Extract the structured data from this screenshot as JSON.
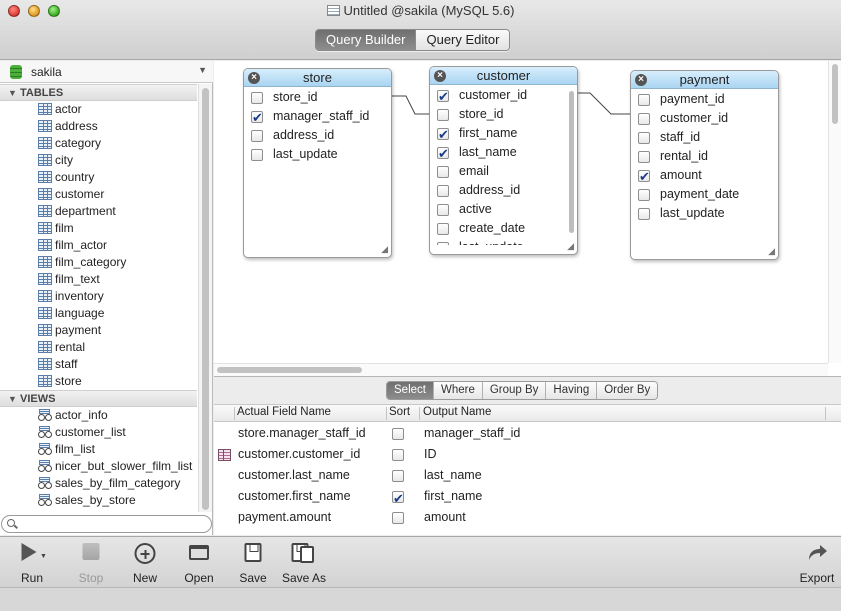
{
  "window": {
    "title": "Untitled @sakila (MySQL 5.6)"
  },
  "mode_tabs": [
    {
      "label": "Query Builder",
      "active": true
    },
    {
      "label": "Query Editor",
      "active": false
    }
  ],
  "sidebar": {
    "database": "sakila",
    "tables_header": "TABLES",
    "tables": [
      "actor",
      "address",
      "category",
      "city",
      "country",
      "customer",
      "department",
      "film",
      "film_actor",
      "film_category",
      "film_text",
      "inventory",
      "language",
      "payment",
      "rental",
      "staff",
      "store"
    ],
    "views_header": "VIEWS",
    "views": [
      "actor_info",
      "customer_list",
      "film_list",
      "nicer_but_slower_film_list",
      "sales_by_film_category",
      "sales_by_store"
    ],
    "search_placeholder": ""
  },
  "canvas": {
    "tables": [
      {
        "name": "store",
        "fields": [
          {
            "name": "store_id",
            "checked": false
          },
          {
            "name": "manager_staff_id",
            "checked": true
          },
          {
            "name": "address_id",
            "checked": false
          },
          {
            "name": "last_update",
            "checked": false
          }
        ]
      },
      {
        "name": "customer",
        "fields": [
          {
            "name": "customer_id",
            "checked": true
          },
          {
            "name": "store_id",
            "checked": false
          },
          {
            "name": "first_name",
            "checked": true
          },
          {
            "name": "last_name",
            "checked": true
          },
          {
            "name": "email",
            "checked": false
          },
          {
            "name": "address_id",
            "checked": false
          },
          {
            "name": "active",
            "checked": false
          },
          {
            "name": "create_date",
            "checked": false
          },
          {
            "name": "last_update",
            "checked": false
          }
        ]
      },
      {
        "name": "payment",
        "fields": [
          {
            "name": "payment_id",
            "checked": false
          },
          {
            "name": "customer_id",
            "checked": false
          },
          {
            "name": "staff_id",
            "checked": false
          },
          {
            "name": "rental_id",
            "checked": false
          },
          {
            "name": "amount",
            "checked": true
          },
          {
            "name": "payment_date",
            "checked": false
          },
          {
            "name": "last_update",
            "checked": false
          }
        ]
      }
    ]
  },
  "query_tabs": [
    {
      "label": "Select",
      "active": true
    },
    {
      "label": "Where",
      "active": false
    },
    {
      "label": "Group By",
      "active": false
    },
    {
      "label": "Having",
      "active": false
    },
    {
      "label": "Order By",
      "active": false
    }
  ],
  "grid": {
    "columns": [
      "Actual Field Name",
      "Sort",
      "Output Name"
    ],
    "rows": [
      {
        "field": "store.manager_staff_id",
        "sort": false,
        "output": "manager_staff_id",
        "selected": false
      },
      {
        "field": "customer.customer_id",
        "sort": false,
        "output": "ID",
        "selected": true
      },
      {
        "field": "customer.last_name",
        "sort": false,
        "output": "last_name",
        "selected": false
      },
      {
        "field": "customer.first_name",
        "sort": true,
        "output": "first_name",
        "selected": false
      },
      {
        "field": "payment.amount",
        "sort": false,
        "output": "amount",
        "selected": false
      }
    ]
  },
  "toolbar": {
    "run": "Run",
    "stop": "Stop",
    "new": "New",
    "open": "Open",
    "save": "Save",
    "save_as": "Save As",
    "export": "Export"
  }
}
